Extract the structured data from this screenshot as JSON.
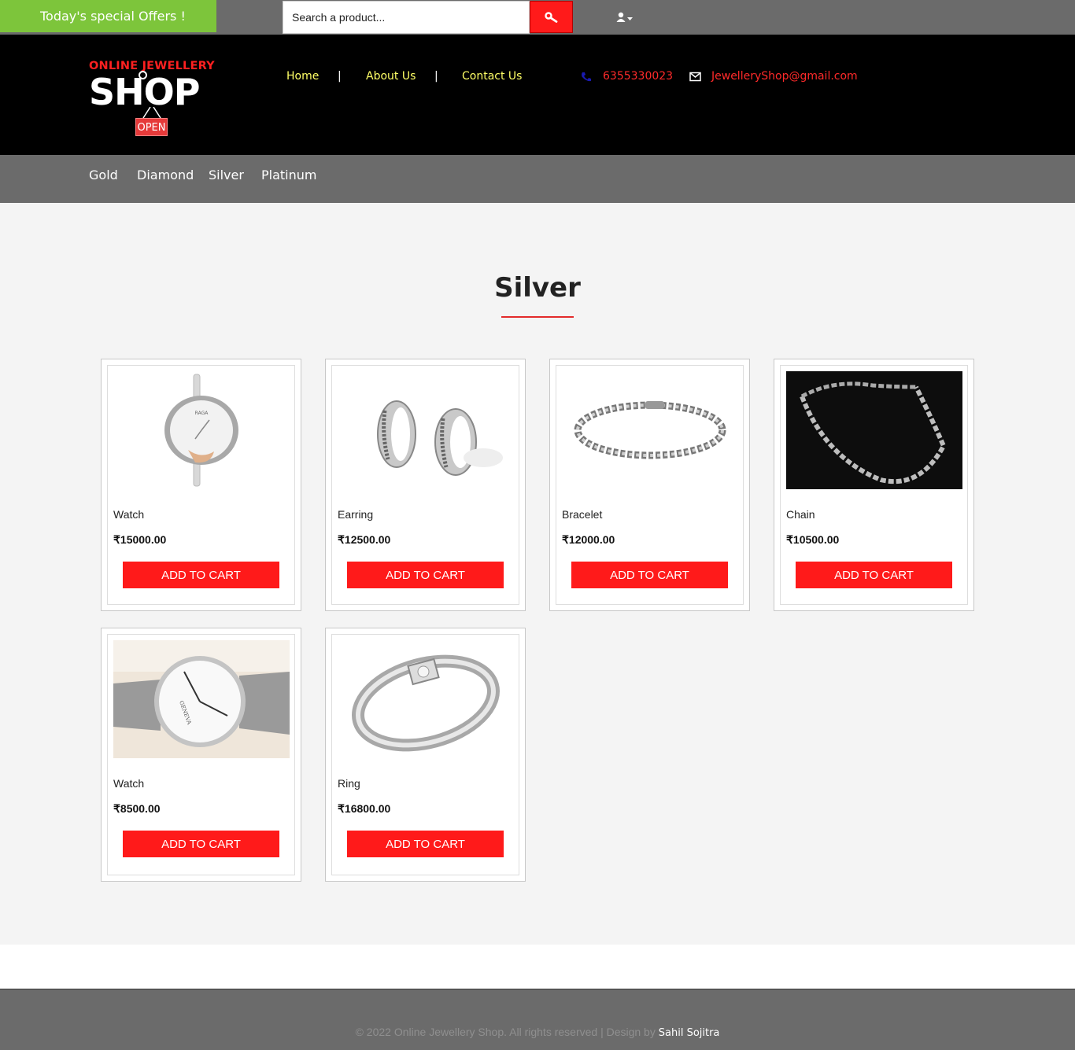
{
  "topbar": {
    "offer_text": "Today's special Offers !",
    "search_placeholder": "Search a product...",
    "search_icon": "search-icon",
    "user_icon": "user-dropdown-icon"
  },
  "header": {
    "logo_line1": "ONLINE JEWELLERY",
    "logo_line2": "SHOP",
    "logo_sign": "OPEN",
    "nav": [
      {
        "label": "Home"
      },
      {
        "label": "About Us"
      },
      {
        "label": "Contact Us"
      }
    ],
    "separator": "|",
    "phone": "6355330023",
    "email": "JewelleryShop@gmail.com",
    "phone_icon": "phone-icon",
    "email_icon": "envelope-icon"
  },
  "categories": [
    "Gold",
    "Diamond",
    "Silver",
    "Platinum"
  ],
  "main": {
    "title": "Silver",
    "button_label": "ADD TO CART",
    "products": [
      {
        "name": "Watch",
        "price": "₹15000.00",
        "image": "silver-bangle-watch"
      },
      {
        "name": "Earring",
        "price": "₹12500.00",
        "image": "silver-hoop-earrings"
      },
      {
        "name": "Bracelet",
        "price": "₹12000.00",
        "image": "silver-chain-bracelet"
      },
      {
        "name": "Chain",
        "price": "₹10500.00",
        "image": "silver-chain-necklace"
      },
      {
        "name": "Watch",
        "price": "₹8500.00",
        "image": "silver-mesh-watch"
      },
      {
        "name": "Ring",
        "price": "₹16800.00",
        "image": "silver-ring"
      }
    ]
  },
  "footer": {
    "text": "© 2022 Online Jewellery Shop. All rights reserved | Design by ",
    "author": "Sahil Sojitra"
  },
  "colors": {
    "accent_red": "#ff1a1a",
    "offer_green": "#7dc53b",
    "nav_yellow": "#ffff66",
    "bar_gray": "#6b6b6b",
    "header_black": "#000000"
  }
}
